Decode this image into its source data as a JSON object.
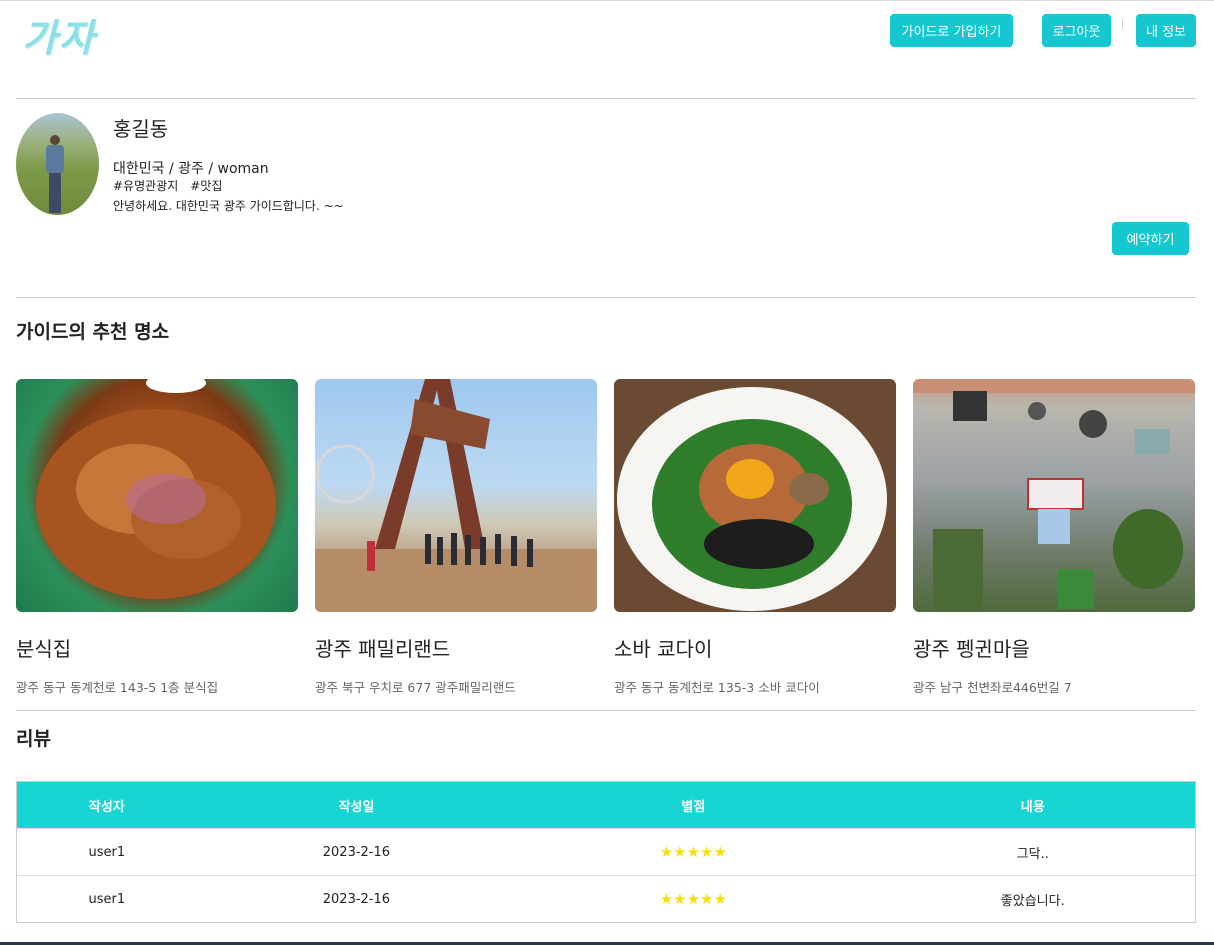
{
  "header": {
    "logo": "가자",
    "join_guide": "가이드로 가입하기",
    "logout": "로그아웃",
    "my_info": "내 정보"
  },
  "profile": {
    "name": "홍길동",
    "location": "대한민국 / 광주 / woman",
    "tags": [
      "#유명관광지",
      "#맛집"
    ],
    "intro": "안녕하세요. 대한민국 광주 가이드합니다. ~~",
    "reserve_button": "예약하기"
  },
  "recommend": {
    "title": "가이드의 추천 명소",
    "places": [
      {
        "name": "분식집",
        "address": "광주 동구 동계천로 143-5 1층 분식집"
      },
      {
        "name": "광주 패밀리랜드",
        "address": "광주 북구 우치로 677 광주패밀리랜드"
      },
      {
        "name": "소바 쿄다이",
        "address": "광주 동구 동계천로 135-3 소바 쿄다이"
      },
      {
        "name": "광주 펭귄마을",
        "address": "광주 남구 천변좌로446번길 7"
      }
    ]
  },
  "reviews": {
    "title": "리뷰",
    "columns": [
      "작성자",
      "작성일",
      "별점",
      "내용"
    ],
    "rows": [
      {
        "author": "user1",
        "date": "2023-2-16",
        "rating": 5,
        "stars": "★★★★★",
        "content": "그닥.."
      },
      {
        "author": "user1",
        "date": "2023-2-16",
        "rating": 5,
        "stars": "★★★★★",
        "content": "좋았습니다."
      }
    ]
  },
  "colors": {
    "accent": "#17c7cf",
    "table_header": "#17d5d3",
    "star": "#f5e10a"
  }
}
